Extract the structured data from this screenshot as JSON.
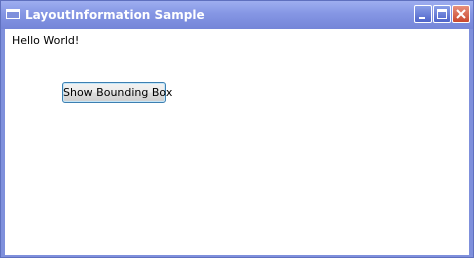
{
  "window": {
    "title": "LayoutInformation Sample",
    "app_icon": "window-icon",
    "controls": {
      "minimize_icon": "minimize-icon",
      "maximize_icon": "maximize-icon",
      "close_icon": "close-icon"
    }
  },
  "content": {
    "text": "Hello World!",
    "button_label": "Show Bounding Box"
  },
  "colors": {
    "title_bar": "#8596e4",
    "window_frame": "#7f90dc",
    "close_button": "#c9482e",
    "button_border": "#3c7fb1",
    "client_background": "#ffffff"
  }
}
